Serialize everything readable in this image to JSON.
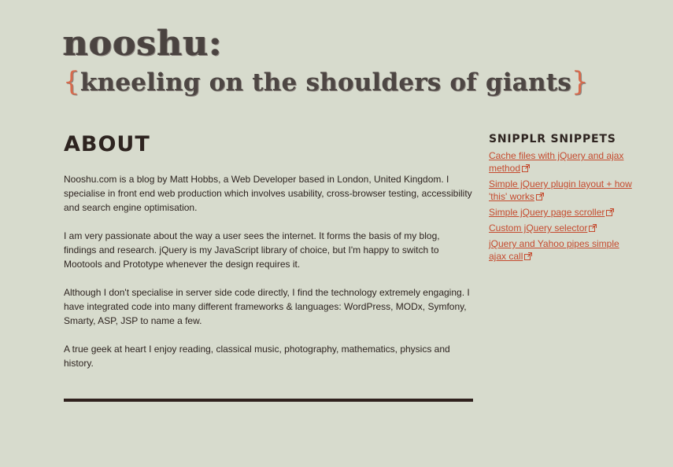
{
  "header": {
    "title": "nooshu:",
    "tagline_open": "{",
    "tagline": "kneeling on the shoulders of giants",
    "tagline_close": "}"
  },
  "main": {
    "heading": "ABOUT",
    "paragraphs": [
      "Nooshu.com is a blog by Matt Hobbs, a Web Developer based in London, United Kingdom. I specialise in front end web production which involves usability, cross-browser testing, accessibility and search engine optimisation.",
      "I am very passionate about the way a user sees the internet. It forms the basis of my blog, findings and research. jQuery is my JavaScript library of choice, but I'm happy to switch to Mootools and Prototype whenever the design requires it.",
      "Although I don't specialise in server side code directly, I find the technology extremely engaging. I have integrated code into many different frameworks & languages: WordPress, MODx, Symfony, Smarty, ASP, JSP to name a few.",
      "A true geek at heart I enjoy reading, classical music, photography, mathematics, physics and history."
    ]
  },
  "sidebar": {
    "heading": "SNIPPLR SNIPPETS",
    "links": [
      {
        "label": "Cache files with jQuery and ajax method",
        "icon": "external-link-icon"
      },
      {
        "label": "Simple jQuery plugin layout + how 'this' works",
        "icon": "external-link-icon"
      },
      {
        "label": "Simple jQuery page scroller",
        "icon": "external-link-icon"
      },
      {
        "label": "Custom jQuery selector",
        "icon": "external-link-icon"
      },
      {
        "label": "jQuery and Yahoo pipes simple ajax call",
        "icon": "external-link-icon"
      }
    ]
  },
  "colors": {
    "background": "#d7dbcd",
    "text": "#2e2420",
    "link": "#c54b2f",
    "brace_accent": "#d86a4c",
    "divider": "#2f211d"
  }
}
